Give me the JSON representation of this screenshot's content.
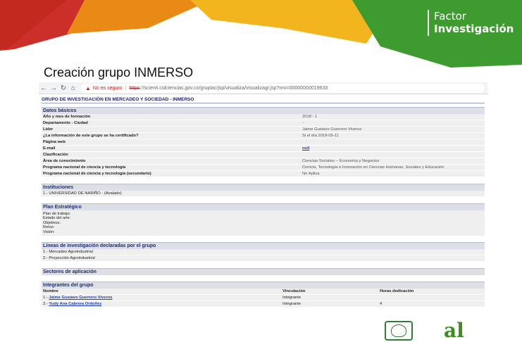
{
  "branding": {
    "line1": "Factor",
    "line2": "Investigación",
    "colors": {
      "green": "#3e9b2f",
      "orange": "#e98a16",
      "red": "#c9231f",
      "yellow": "#f2b51d"
    }
  },
  "slide_title": "Creación grupo INMERSO",
  "browser": {
    "back_icon": "back-arrow-icon",
    "forward_icon": "forward-arrow-icon",
    "reload_icon": "reload-icon",
    "home_icon": "home-icon",
    "security_label": "No es seguro",
    "url_scheme": "https",
    "url_rest": "://scienti.colciencias.gov.co/gruplac/jsp/visualiza/visualizagr.jsp?nro=00000000019633"
  },
  "page": {
    "group_title": "GRUPO DE INVESTIGACIÓN EN MERCADEO Y SOCIEDAD - INMERSO",
    "datos_basicos": {
      "header": "Datos básicos",
      "rows": [
        {
          "k": "Año y mes de formación",
          "v": "2018 - 1"
        },
        {
          "k": "Departamento - Ciudad",
          "v": "-"
        },
        {
          "k": "Líder",
          "v": "Jaime Gustavo Guerrero Viveros"
        },
        {
          "k": "¿La información de este grupo se ha certificado?",
          "v": "Si el día 2018-05-11"
        },
        {
          "k": "Página web",
          "v": ""
        },
        {
          "k": "E-mail",
          "v": "null"
        },
        {
          "k": "Clasificación",
          "v": ""
        },
        {
          "k": "Área de conocimiento",
          "v": "Ciencias Sociales -- Economía y Negocios"
        },
        {
          "k": "Programa nacional de ciencia y tecnología",
          "v": "Ciencia, Tecnología e Innovación en Ciencias Humanas, Sociales y Educación"
        },
        {
          "k": "Programa nacional de ciencia y tecnología (secundario)",
          "v": "No Aplica"
        }
      ]
    },
    "instituciones": {
      "header": "Instituciones",
      "items": [
        "1.- UNIVERSIDAD DE NARIÑO - (Avalado)"
      ]
    },
    "plan": {
      "header": "Plan Estratégico",
      "lines": [
        "Plan de trabajo:",
        "Estado del arte:",
        "Objetivos:",
        "Retos:",
        "Visión:"
      ]
    },
    "lineas": {
      "header": "Líneas de investigación declaradas por el grupo",
      "items": [
        "1.- Mercadeo Agroindustrial",
        "2.- Proyección Agroindustrial"
      ]
    },
    "sectores": {
      "header": "Sectores de aplicación"
    },
    "integrantes": {
      "header": "Integrantes del grupo",
      "columns": [
        "Nombre",
        "Vinculación",
        "Horas dedicación"
      ],
      "rows": [
        {
          "num": "1.-",
          "name": "Jaime Gustavo Guerrero Viveros",
          "vinc": "Integrante",
          "horas": ""
        },
        {
          "num": "2.-",
          "name": "Yudy Ana Cabrera Ordoñez",
          "vinc": "Integrante",
          "horas": "4"
        }
      ]
    }
  },
  "footer_logos": {
    "logo1": "university-seal-icon",
    "logo2_text": "al"
  }
}
